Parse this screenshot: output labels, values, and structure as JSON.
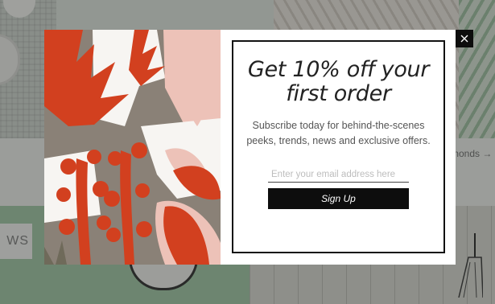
{
  "background": {
    "link_fragment": "monds →",
    "news_button_fragment": "WS"
  },
  "modal": {
    "title_line1": "Get 10% off your",
    "title_line2": "first order",
    "description": "Subscribe today for behind-the-scenes peeks, trends, news and exclusive offers.",
    "email_placeholder": "Enter your email address here",
    "email_value": "",
    "signup_label": "Sign Up",
    "close_icon": "close-icon",
    "art_colors": {
      "red": "#d2401f",
      "taupe": "#8a8177",
      "pink": "#edc2b8",
      "white": "#f7f5f2",
      "olive": "#6f6a5a"
    }
  }
}
